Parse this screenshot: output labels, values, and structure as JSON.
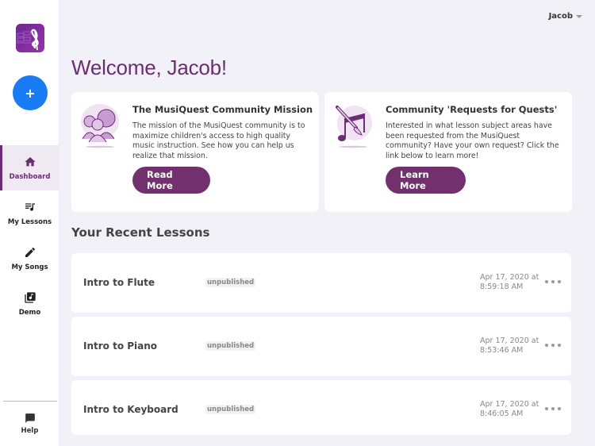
{
  "app": {
    "name": "MusiQuest",
    "colors": {
      "brand_purple": "#6b2d74",
      "button_purple": "#72306f",
      "add_blue": "#1a7cf5",
      "background": "#f2f1f7"
    }
  },
  "sidebar": {
    "logo_icon": "treble-clef-logo-icon",
    "add_button": {
      "label": "+",
      "icon": "plus-icon"
    },
    "items": [
      {
        "label": "Dashboard",
        "icon": "home-icon",
        "active": true
      },
      {
        "label": "My Lessons",
        "icon": "playlist-music-icon",
        "active": false
      },
      {
        "label": "My Songs",
        "icon": "pencil-icon",
        "active": false
      },
      {
        "label": "Demo",
        "icon": "library-music-icon",
        "active": false
      }
    ],
    "help": {
      "label": "Help",
      "icon": "chat-bubble-icon"
    }
  },
  "header": {
    "user_name": "Jacob",
    "welcome": "Welcome, Jacob!"
  },
  "feature_cards": [
    {
      "title": "The MusiQuest Community Mission",
      "description": "The mission of the MusiQuest community is to maximize children's access to high quality music instruction. See how you can help us realize that mission.",
      "button_label": "Read More",
      "illustration": "community-people-icon"
    },
    {
      "title": "Community 'Requests for Quests'",
      "description": "Interested in what lesson subject areas have been requested from the MusiQuest community? Have your own request? Click the link below to learn more!",
      "button_label": "Learn More",
      "illustration": "music-note-brush-icon"
    }
  ],
  "recent_lessons": {
    "title": "Your Recent Lessons",
    "items": [
      {
        "name": "Intro to Flute",
        "status": "unpublished",
        "date_line1": "Apr 17, 2020 at",
        "date_line2": "8:59:18 AM"
      },
      {
        "name": "Intro to Piano",
        "status": "unpublished",
        "date_line1": "Apr 17, 2020 at",
        "date_line2": "8:53:46 AM"
      },
      {
        "name": "Intro to Keyboard",
        "status": "unpublished",
        "date_line1": "Apr 17, 2020 at",
        "date_line2": "8:46:05 AM"
      }
    ]
  }
}
